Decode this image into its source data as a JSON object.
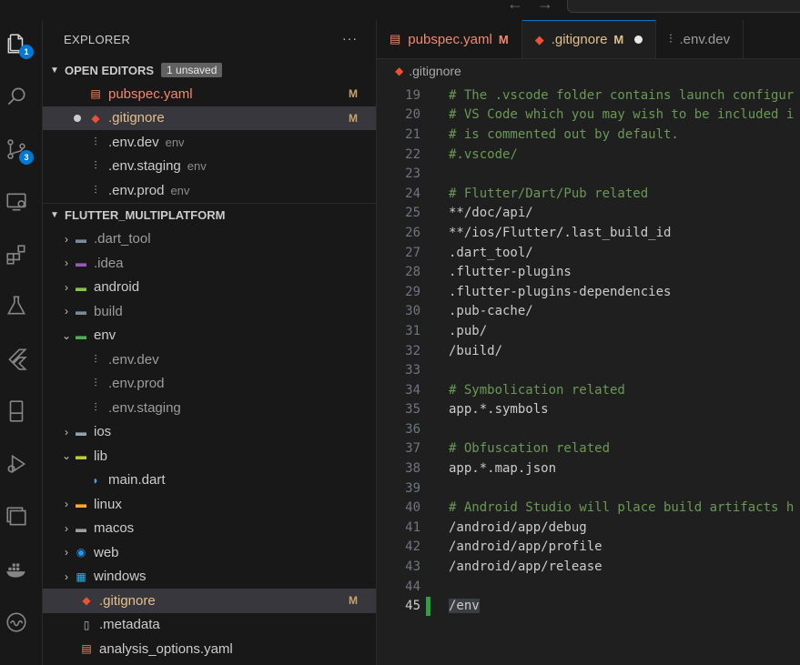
{
  "activity_bar": {
    "explorer_badge": "1",
    "source_control_badge": "3"
  },
  "sidebar": {
    "title": "EXPLORER",
    "more_label": "···",
    "open_editors": {
      "title": "OPEN EDITORS",
      "badge": "1 unsaved",
      "items": [
        {
          "name": "pubspec.yaml",
          "desc": "",
          "mark": "M"
        },
        {
          "name": ".gitignore",
          "desc": "",
          "mark": "M"
        },
        {
          "name": ".env.dev",
          "desc": "env",
          "mark": ""
        },
        {
          "name": ".env.staging",
          "desc": "env",
          "mark": ""
        },
        {
          "name": ".env.prod",
          "desc": "env",
          "mark": ""
        }
      ]
    },
    "project": {
      "title": "FLUTTER_MULTIPLATFORM",
      "items": [
        {
          "name": ".dart_tool",
          "mark": ""
        },
        {
          "name": ".idea",
          "mark": ""
        },
        {
          "name": "android",
          "mark": ""
        },
        {
          "name": "build",
          "mark": ""
        },
        {
          "name": "env",
          "mark": ""
        },
        {
          "name": ".env.dev",
          "mark": ""
        },
        {
          "name": ".env.prod",
          "mark": ""
        },
        {
          "name": ".env.staging",
          "mark": ""
        },
        {
          "name": "ios",
          "mark": ""
        },
        {
          "name": "lib",
          "mark": ""
        },
        {
          "name": "main.dart",
          "mark": ""
        },
        {
          "name": "linux",
          "mark": ""
        },
        {
          "name": "macos",
          "mark": ""
        },
        {
          "name": "web",
          "mark": ""
        },
        {
          "name": "windows",
          "mark": ""
        },
        {
          "name": ".gitignore",
          "mark": "M"
        },
        {
          "name": ".metadata",
          "mark": ""
        },
        {
          "name": "analysis_options.yaml",
          "mark": ""
        }
      ]
    }
  },
  "tabs": [
    {
      "label": "pubspec.yaml",
      "mark": "M"
    },
    {
      "label": ".gitignore",
      "mark": "M"
    },
    {
      "label": ".env.dev",
      "mark": ""
    }
  ],
  "breadcrumb": ".gitignore",
  "code_lines": [
    {
      "n": "19",
      "text": "# The .vscode folder contains launch configur"
    },
    {
      "n": "20",
      "text": "# VS Code which you may wish to be included i"
    },
    {
      "n": "21",
      "text": "# is commented out by default."
    },
    {
      "n": "22",
      "text": "#.vscode/"
    },
    {
      "n": "23",
      "text": ""
    },
    {
      "n": "24",
      "text": "# Flutter/Dart/Pub related"
    },
    {
      "n": "25",
      "text": "**/doc/api/"
    },
    {
      "n": "26",
      "text": "**/ios/Flutter/.last_build_id"
    },
    {
      "n": "27",
      "text": ".dart_tool/"
    },
    {
      "n": "28",
      "text": ".flutter-plugins"
    },
    {
      "n": "29",
      "text": ".flutter-plugins-dependencies"
    },
    {
      "n": "30",
      "text": ".pub-cache/"
    },
    {
      "n": "31",
      "text": ".pub/"
    },
    {
      "n": "32",
      "text": "/build/"
    },
    {
      "n": "33",
      "text": ""
    },
    {
      "n": "34",
      "text": "# Symbolication related"
    },
    {
      "n": "35",
      "text": "app.*.symbols"
    },
    {
      "n": "36",
      "text": ""
    },
    {
      "n": "37",
      "text": "# Obfuscation related"
    },
    {
      "n": "38",
      "text": "app.*.map.json"
    },
    {
      "n": "39",
      "text": ""
    },
    {
      "n": "40",
      "text": "# Android Studio will place build artifacts h"
    },
    {
      "n": "41",
      "text": "/android/app/debug"
    },
    {
      "n": "42",
      "text": "/android/app/profile"
    },
    {
      "n": "43",
      "text": "/android/app/release"
    },
    {
      "n": "44",
      "text": ""
    },
    {
      "n": "45",
      "text": "/env"
    }
  ],
  "colors": {
    "accent": "#0078d4",
    "modified": "#e2c08d",
    "comment": "#6a9955",
    "added_gutter": "#2ea043"
  }
}
